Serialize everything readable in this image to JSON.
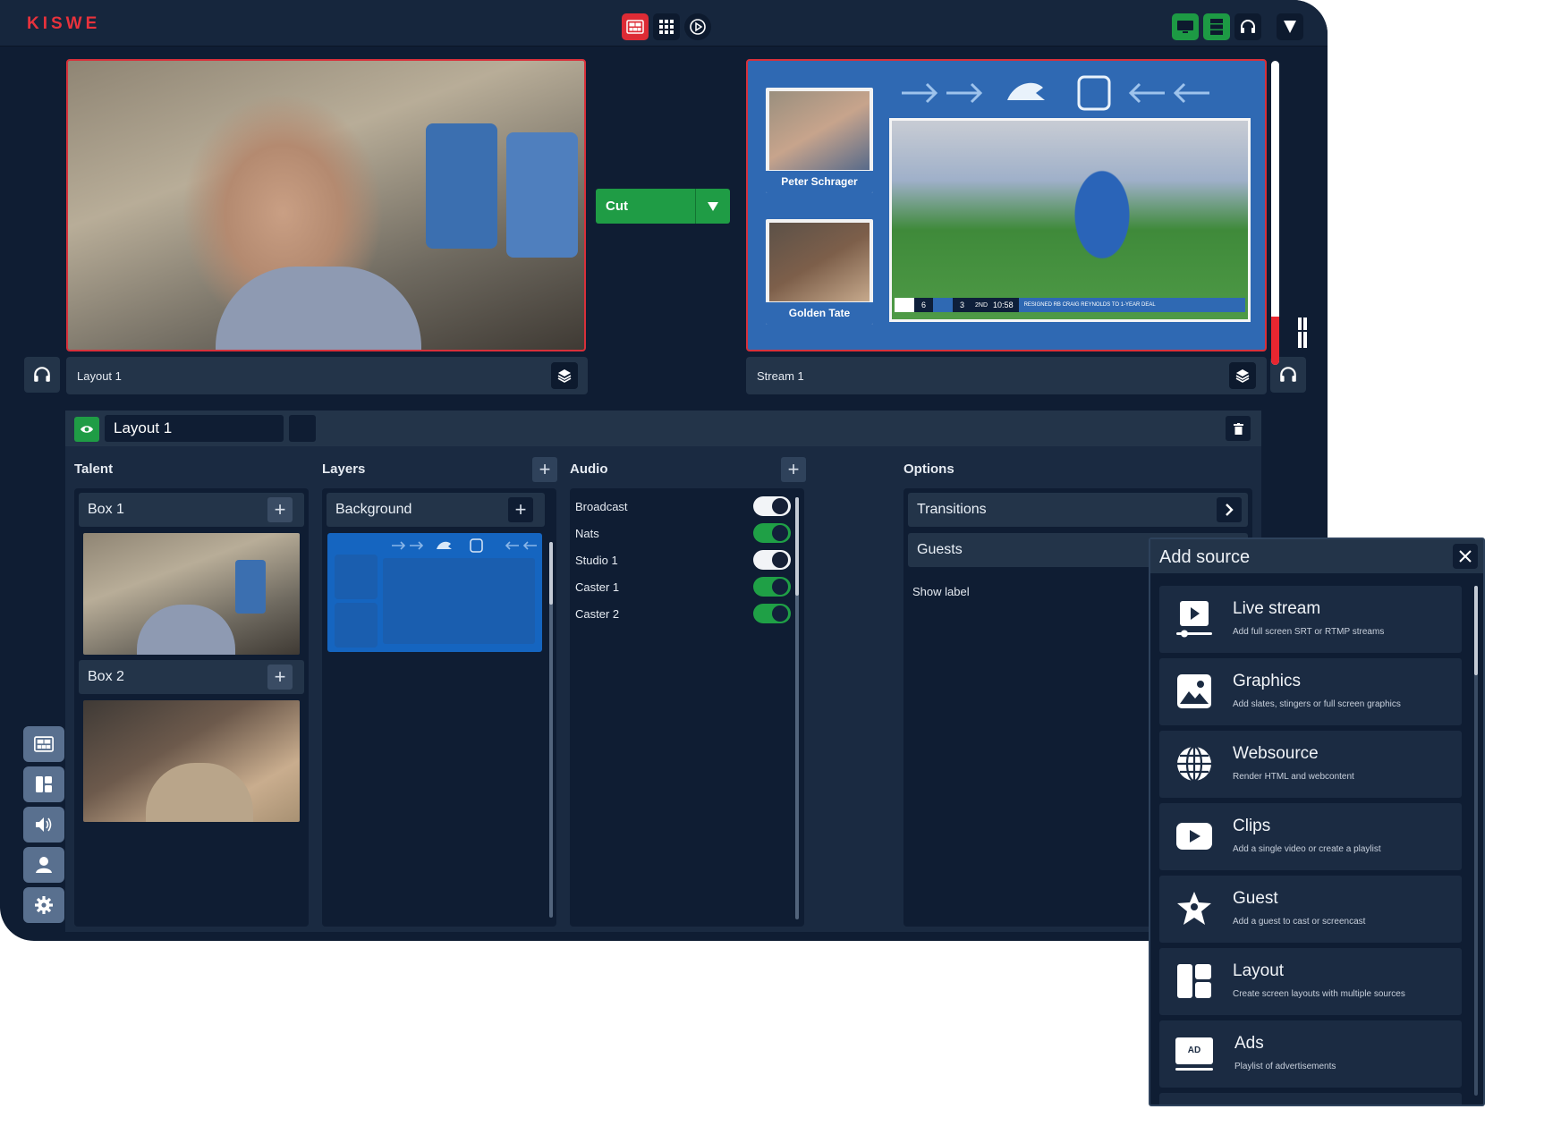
{
  "brand": {
    "logo": "KISWE",
    "accent": "#e8323c",
    "green": "#1f9c45"
  },
  "topbar": {
    "center_icons": [
      "multiview-icon",
      "grid-icon",
      "replay-icon"
    ],
    "right_icons": [
      "monitor-icon",
      "server-icon",
      "headset-icon",
      "shield-icon"
    ]
  },
  "preview": {
    "label": "Layout 1",
    "icon": "layers-icon"
  },
  "program": {
    "label": "Stream 1",
    "talent_names": [
      "Peter Schrager",
      "Golden Tate"
    ],
    "score_bug": {
      "score_left": "6",
      "score_right": "3",
      "quarter": "2ND",
      "clock": "10:58",
      "ticker": "RESIGNED RB CRAIG REYNOLDS TO 1-YEAR DEAL"
    },
    "audio_level": 0.16
  },
  "cut": {
    "label": "Cut"
  },
  "editor": {
    "layout_name": "Layout 1",
    "sections": {
      "talent": "Talent",
      "layers": "Layers",
      "audio": "Audio",
      "options": "Options"
    },
    "talent_boxes": [
      {
        "label": "Box 1"
      },
      {
        "label": "Box 2"
      }
    ],
    "layers": [
      {
        "label": "Background"
      }
    ],
    "audio": [
      {
        "label": "Broadcast",
        "on": false
      },
      {
        "label": "Nats",
        "on": true
      },
      {
        "label": "Studio 1",
        "on": false
      },
      {
        "label": "Caster 1",
        "on": true
      },
      {
        "label": "Caster 2",
        "on": true
      }
    ],
    "options": {
      "transitions": "Transitions",
      "guests": "Guests",
      "show_label": "Show label"
    }
  },
  "sidenav": [
    "multiview-icon",
    "layout-icon",
    "audio-icon",
    "talent-icon",
    "settings-icon"
  ],
  "add_source": {
    "title": "Add source",
    "items": [
      {
        "title": "Live stream",
        "desc": "Add full screen SRT or RTMP streams",
        "icon": "live-stream-icon"
      },
      {
        "title": "Graphics",
        "desc": "Add slates, stingers or full screen graphics",
        "icon": "image-icon"
      },
      {
        "title": "Websource",
        "desc": "Render HTML and webcontent",
        "icon": "globe-icon"
      },
      {
        "title": "Clips",
        "desc": "Add a single video or create a playlist",
        "icon": "play-icon"
      },
      {
        "title": "Guest",
        "desc": "Add a guest to cast or screencast",
        "icon": "guest-icon"
      },
      {
        "title": "Layout",
        "desc": "Create screen layouts with multiple sources",
        "icon": "layout-icon"
      },
      {
        "title": "Ads",
        "desc": "Playlist of advertisements",
        "icon": "ad-icon",
        "badge": "AD"
      }
    ]
  }
}
